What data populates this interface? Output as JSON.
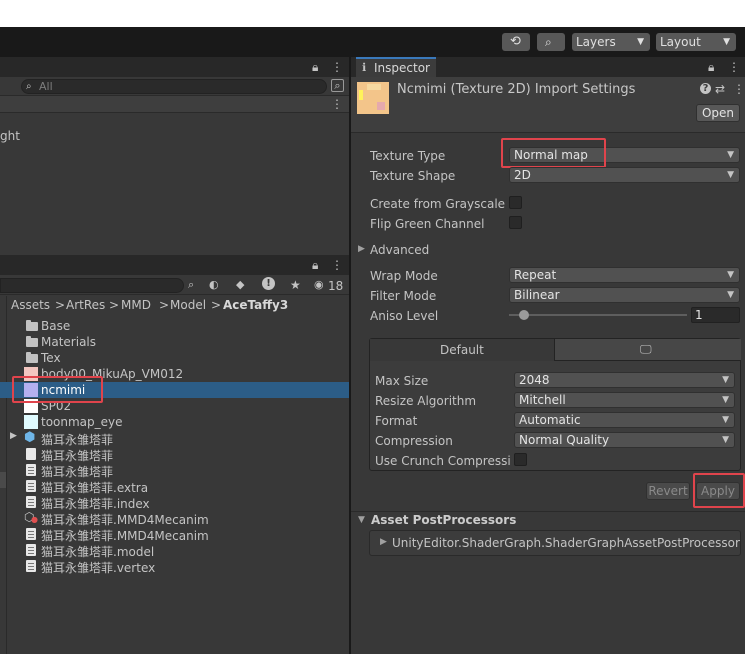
{
  "toolbar": {
    "layers_label": "Layers",
    "layout_label": "Layout"
  },
  "hierarchy": {
    "search_placeholder": "All",
    "partial_item": "ght"
  },
  "project": {
    "visible_count": "18",
    "breadcrumb": [
      "Assets",
      "ArtRes",
      "MMD",
      "Model",
      "AceTaffy3"
    ],
    "items": [
      {
        "label": "Base",
        "icon": "folder"
      },
      {
        "label": "Materials",
        "icon": "folder"
      },
      {
        "label": "Tex",
        "icon": "folder"
      },
      {
        "label": "body00_MikuAp_VM012",
        "icon": "texture"
      },
      {
        "label": "ncmimi",
        "icon": "texture",
        "selected": true
      },
      {
        "label": "SP02",
        "icon": "texture"
      },
      {
        "label": "toonmap_eye",
        "icon": "texture"
      },
      {
        "label": "猫耳永雏塔菲",
        "icon": "prefab"
      },
      {
        "label": "猫耳永雏塔菲",
        "icon": "document"
      },
      {
        "label": "猫耳永雏塔菲",
        "icon": "document"
      },
      {
        "label": "猫耳永雏塔菲.extra",
        "icon": "document"
      },
      {
        "label": "猫耳永雏塔菲.index",
        "icon": "document"
      },
      {
        "label": "猫耳永雏塔菲.MMD4Mecanim",
        "icon": "mmd-asset"
      },
      {
        "label": "猫耳永雏塔菲.MMD4Mecanim",
        "icon": "document"
      },
      {
        "label": "猫耳永雏塔菲.model",
        "icon": "document"
      },
      {
        "label": "猫耳永雏塔菲.vertex",
        "icon": "document"
      }
    ]
  },
  "inspector": {
    "tab_label": "Inspector",
    "title": "Ncmimi (Texture 2D) Import Settings",
    "open_button": "Open",
    "fields": {
      "texture_type": {
        "label": "Texture Type",
        "value": "Normal map"
      },
      "texture_shape": {
        "label": "Texture Shape",
        "value": "2D"
      },
      "create_from_grayscale": {
        "label": "Create from Grayscale"
      },
      "flip_green_channel": {
        "label": "Flip Green Channel"
      },
      "advanced": {
        "label": "Advanced"
      },
      "wrap_mode": {
        "label": "Wrap Mode",
        "value": "Repeat"
      },
      "filter_mode": {
        "label": "Filter Mode",
        "value": "Bilinear"
      },
      "aniso_level": {
        "label": "Aniso Level",
        "value": "1"
      }
    },
    "platform": {
      "default_tab": "Default",
      "max_size": {
        "label": "Max Size",
        "value": "2048"
      },
      "resize_algorithm": {
        "label": "Resize Algorithm",
        "value": "Mitchell"
      },
      "format": {
        "label": "Format",
        "value": "Automatic"
      },
      "compression": {
        "label": "Compression",
        "value": "Normal Quality"
      },
      "use_crunch": {
        "label": "Use Crunch Compressio"
      }
    },
    "revert_button": "Revert",
    "apply_button": "Apply",
    "postprocessors": {
      "header": "Asset PostProcessors",
      "item": "UnityEditor.ShaderGraph.ShaderGraphAssetPostProcessor"
    }
  },
  "colors": {
    "highlight": "#e0444c",
    "selection": "#2c5d87",
    "panel": "#383838",
    "dark": "#191919"
  }
}
